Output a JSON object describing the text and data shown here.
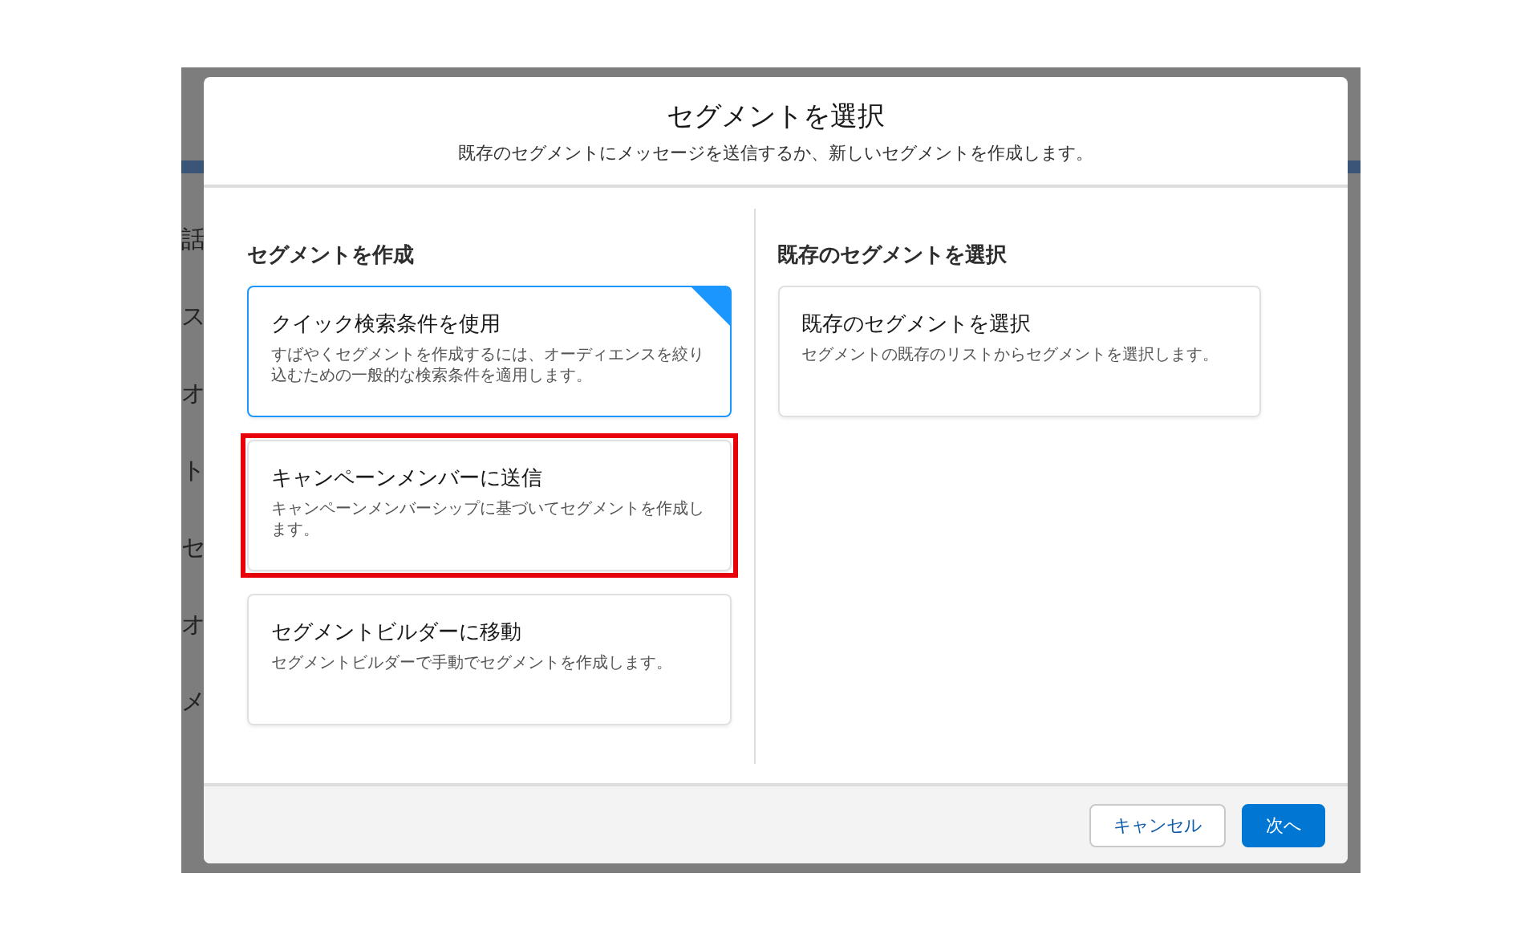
{
  "background": {
    "fragments": [
      {
        "text": "話"
      },
      {
        "text": "ス"
      },
      {
        "text": "オ"
      },
      {
        "text": "ト"
      },
      {
        "text": "セ"
      },
      {
        "text": "オ"
      },
      {
        "text": "メ"
      }
    ]
  },
  "modal": {
    "title": "セグメントを選択",
    "subtitle": "既存のセグメントにメッセージを送信するか、新しいセグメントを作成します。",
    "sections": [
      {
        "heading": "セグメントを作成",
        "cards": [
          {
            "title": "クイック検索条件を使用",
            "description": "すばやくセグメントを作成するには、オーディエンスを絞り込むための一般的な検索条件を適用します。",
            "selected": true,
            "highlighted": false
          },
          {
            "title": "キャンペーンメンバーに送信",
            "description": "キャンペーンメンバーシップに基づいてセグメントを作成します。",
            "selected": false,
            "highlighted": true
          },
          {
            "title": "セグメントビルダーに移動",
            "description": "セグメントビルダーで手動でセグメントを作成します。",
            "selected": false,
            "highlighted": false
          }
        ]
      },
      {
        "heading": "既存のセグメントを選択",
        "cards": [
          {
            "title": "既存のセグメントを選択",
            "description": "セグメントの既存のリストからセグメントを選択します。",
            "selected": false,
            "highlighted": false
          }
        ]
      }
    ],
    "buttons": [
      {
        "label": "キャンセル",
        "kind": "neutral"
      },
      {
        "label": "次へ",
        "kind": "brand"
      }
    ]
  }
}
